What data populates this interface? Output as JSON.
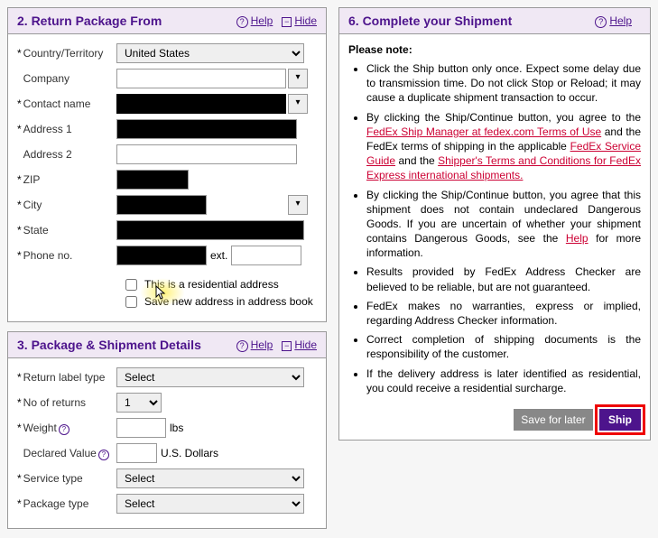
{
  "section2": {
    "title": "2. Return Package From",
    "help": "Help",
    "hide": "Hide",
    "labels": {
      "country": "Country/Territory",
      "company": "Company",
      "contact": "Contact name",
      "addr1": "Address 1",
      "addr2": "Address 2",
      "zip": "ZIP",
      "city": "City",
      "state": "State",
      "phone": "Phone no.",
      "ext": "ext."
    },
    "values": {
      "country": "United States"
    },
    "checkboxes": {
      "residential": "This is a residential address",
      "save": "Save new address in address book"
    }
  },
  "section3": {
    "title": "3. Package & Shipment Details",
    "help": "Help",
    "hide": "Hide",
    "labels": {
      "returnLabel": "Return label type",
      "noReturns": "No of returns",
      "weight": "Weight",
      "weightUnit": "lbs",
      "declared": "Declared Value",
      "currency": "U.S. Dollars",
      "service": "Service type",
      "package": "Package type"
    },
    "values": {
      "returnLabel": "Select",
      "noReturns": "1",
      "service": "Select",
      "package": "Select"
    }
  },
  "section6": {
    "title": "6. Complete your Shipment",
    "help": "Help",
    "pleaseNote": "Please note:",
    "bullets": {
      "b1a": "Click the Ship button only once. Expect some delay due to transmission time. Do not click Stop or Reload; it may cause a duplicate shipment transaction to occur.",
      "b2a": "By clicking the Ship/Continue button, you agree to the ",
      "b2link1": "FedEx Ship Manager at fedex.com Terms of Use",
      "b2b": " and the FedEx terms of shipping in the applicable ",
      "b2link2": "FedEx Service Guide",
      "b2c": " and the ",
      "b2link3": "Shipper's Terms and Conditions for FedEx Express international shipments.",
      "b3a": "By clicking the Ship/Continue button, you agree that this shipment does not contain undeclared Dangerous Goods. If you are uncertain of whether your shipment contains Dangerous Goods, see the ",
      "b3link": "Help",
      "b3b": " for more information.",
      "b4": "Results provided by FedEx Address Checker are believed to be reliable, but are not guaranteed.",
      "b5": "FedEx makes no warranties, express or implied, regarding Address Checker information.",
      "b6": "Correct completion of shipping documents is the responsibility of the customer.",
      "b7": "If the delivery address is later identified as residential, you could receive a residential surcharge."
    },
    "buttons": {
      "save": "Save for later",
      "ship": "Ship"
    }
  }
}
